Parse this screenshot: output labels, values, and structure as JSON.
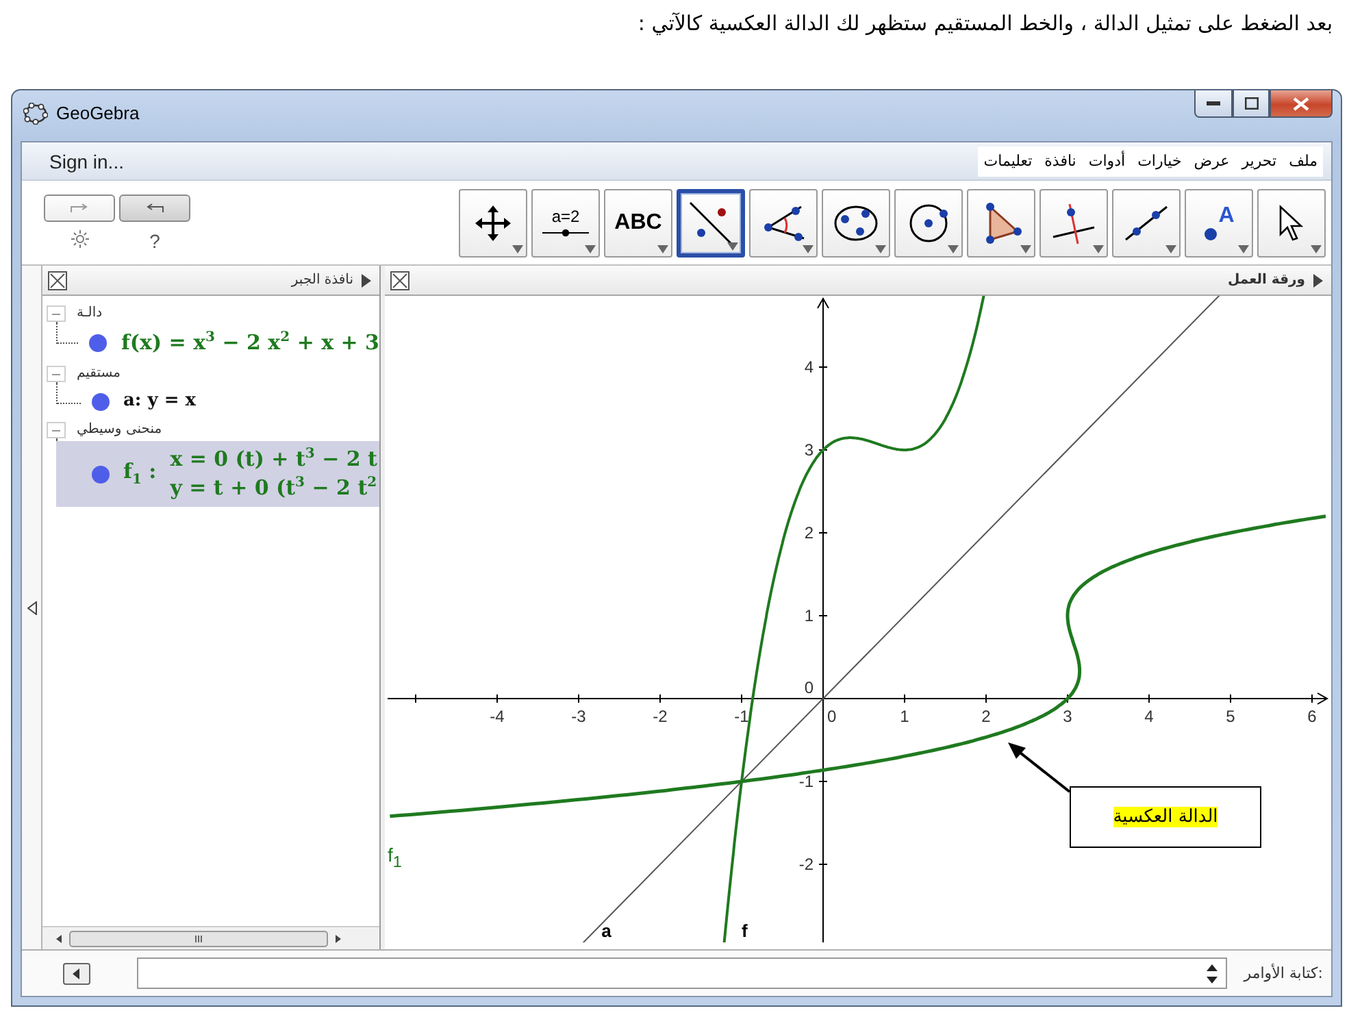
{
  "caption": "بعد الضغط على تمثيل الدالة ، والخط المستقيم ستظهر لك الدالة العكسية كالآتي :",
  "window": {
    "title": "GeoGebra"
  },
  "menu": {
    "sign_in": "Sign in...",
    "items": [
      "ملف",
      "تحرير",
      "عرض",
      "خيارات",
      "أدوات",
      "نافذة",
      "تعليمات"
    ]
  },
  "history": [
    {
      "kind": "redo",
      "disabled": true
    },
    {
      "kind": "undo",
      "disabled": false
    }
  ],
  "help": "?",
  "tools": [
    {
      "kind": "pointer",
      "selected": false
    },
    {
      "kind": "point",
      "label": "A",
      "selected": false
    },
    {
      "kind": "line",
      "selected": false
    },
    {
      "kind": "perpendicular",
      "selected": false
    },
    {
      "kind": "polygon",
      "selected": false
    },
    {
      "kind": "circle",
      "selected": false
    },
    {
      "kind": "conic",
      "selected": false
    },
    {
      "kind": "angle",
      "selected": false
    },
    {
      "kind": "reflect",
      "selected": true
    },
    {
      "kind": "text",
      "label": "ABC",
      "selected": false
    },
    {
      "kind": "slider",
      "label": "a=2",
      "selected": false
    },
    {
      "kind": "move",
      "selected": false
    }
  ],
  "algebra": {
    "title": "نافذة الجبر",
    "groups": [
      {
        "label": "دالـة",
        "expanded": true,
        "children": [
          {
            "kind": "function",
            "selected": false,
            "lines": [
              "f(x) = x$^{3}$ − 2 x$^{2}$ + x + 3"
            ]
          }
        ]
      },
      {
        "label": "مستقيم",
        "expanded": true,
        "children": [
          {
            "kind": "line",
            "selected": false,
            "lines": [
              "a: y = x"
            ]
          }
        ]
      },
      {
        "label": "منحنى وسيطي",
        "expanded": true,
        "children": [
          {
            "kind": "curve",
            "selected": true,
            "name": "f$_{1}$ :",
            "lines": [
              "x = 0  (t) + t$^{3}$ − 2 t",
              "y = t + 0  (t$^{3}$ − 2 t$^{2}$"
            ]
          }
        ]
      }
    ]
  },
  "graphics": {
    "title": "ورقة العمل",
    "x_ticks": [
      "6",
      "5",
      "4",
      "3",
      "2",
      "1",
      "0",
      "-1",
      "-2",
      "-3",
      "-4"
    ],
    "y_ticks": [
      "4",
      "3",
      "2",
      "1",
      "0",
      "-1",
      "-2"
    ],
    "labels": {
      "line": "a",
      "function": "f",
      "curve": "f$_{1}$"
    },
    "callout": "الدالة العكسية"
  },
  "input_bar": {
    "label": "كتابة الأوامر:"
  }
}
